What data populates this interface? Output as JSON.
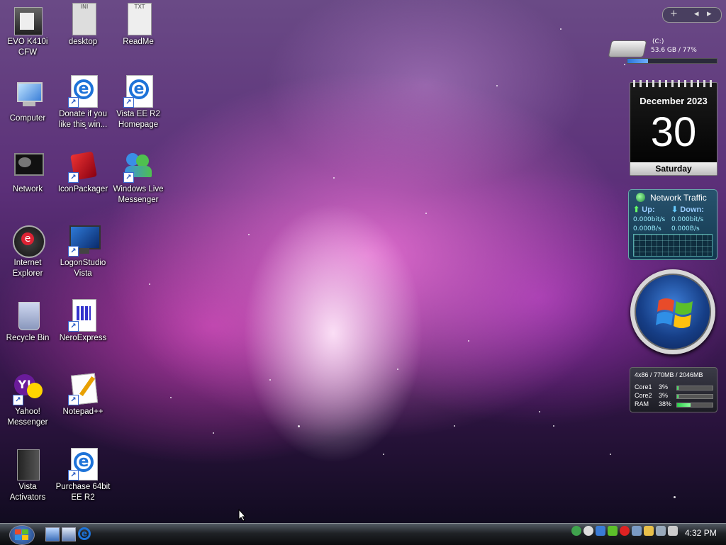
{
  "desktop_icons": [
    {
      "label": "EVO K410i CFW",
      "icon": "archive-icon",
      "shortcut": false
    },
    {
      "label": "desktop",
      "icon": "ini-file-icon",
      "shortcut": false,
      "badge": "INI"
    },
    {
      "label": "ReadMe",
      "icon": "txt-file-icon",
      "shortcut": false,
      "badge": "TXT"
    },
    {
      "label": "Computer",
      "icon": "computer-icon",
      "shortcut": false
    },
    {
      "label": "Donate if you like this win...",
      "icon": "internet-explorer-icon",
      "shortcut": true
    },
    {
      "label": "Vista EE R2 Homepage",
      "icon": "internet-explorer-icon",
      "shortcut": true
    },
    {
      "label": "Network",
      "icon": "network-icon",
      "shortcut": false
    },
    {
      "label": "IconPackager",
      "icon": "iconpackager-icon",
      "shortcut": true
    },
    {
      "label": "Windows Live Messenger",
      "icon": "messenger-icon",
      "shortcut": true
    },
    {
      "label": "Internet Explorer",
      "icon": "internet-explorer-icon",
      "shortcut": false
    },
    {
      "label": "LogonStudio Vista",
      "icon": "logonstudio-icon",
      "shortcut": true
    },
    {
      "label": "Recycle Bin",
      "icon": "recycle-bin-icon",
      "shortcut": false
    },
    {
      "label": "NeroExpress",
      "icon": "neroexpress-icon",
      "shortcut": true
    },
    {
      "label": "Yahoo! Messenger",
      "icon": "yahoo-messenger-icon",
      "shortcut": true
    },
    {
      "label": "Notepad++",
      "icon": "notepad-plus-icon",
      "shortcut": true
    },
    {
      "label": "Vista Activators",
      "icon": "folder-icon",
      "shortcut": false
    },
    {
      "label": "Purchase 64bit EE R2",
      "icon": "internet-explorer-icon",
      "shortcut": true
    }
  ],
  "sidebar_controls": {
    "add": "+",
    "prev": "◂",
    "next": "▸"
  },
  "drive_gadget": {
    "drive": "(C:)",
    "usage": "53.6 GB / 77%",
    "used_fraction": 0.23
  },
  "calendar_gadget": {
    "month_year": "December 2023",
    "day": "30",
    "weekday": "Saturday"
  },
  "network_gadget": {
    "title": "Network Traffic",
    "up_label": "Up:",
    "down_label": "Down:",
    "up_bits": "0.000bit/s",
    "down_bits": "0.000bit/s",
    "up_bytes": "0.000B/s",
    "down_bytes": "0.000B/s"
  },
  "cpu_gadget": {
    "header": "4x86 / 770MB / 2046MB",
    "rows": [
      {
        "label": "Core1",
        "value": "3%",
        "fraction": 0.03
      },
      {
        "label": "Core2",
        "value": "3%",
        "fraction": 0.03
      },
      {
        "label": "RAM",
        "value": "38%",
        "fraction": 0.38
      }
    ]
  },
  "taskbar": {
    "clock": "4:32 PM",
    "quick_launch": [
      "show-desktop-icon",
      "switch-windows-icon",
      "internet-explorer-icon"
    ],
    "tray_icons": [
      "messenger-tray-icon",
      "yahoo-tray-icon",
      "bluetooth-tray-icon",
      "network-tray-icon",
      "security-tray-icon",
      "safely-remove-tray-icon",
      "power-tray-icon",
      "network-connection-tray-icon",
      "volume-muted-tray-icon"
    ]
  },
  "colors": {
    "taskbar": "#1f2226",
    "accent": "#3a6bd0"
  }
}
